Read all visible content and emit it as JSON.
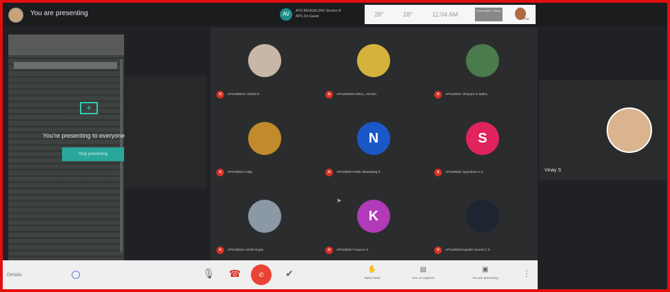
{
  "topbar": {
    "presenting_label": "You are presenting",
    "meeting_badge": "AV",
    "meeting_line1": "APS BENGALURU Section-A",
    "meeting_line2": "APS Zin-Gaute",
    "temp": "28°",
    "weather": "28°",
    "time": "11:04 AM",
    "presenter_chip": "Presentation: Vinay",
    "you_label": "You"
  },
  "share": {
    "headline": "You're presenting to everyone",
    "stop_label": "Stop presenting"
  },
  "participants": [
    {
      "name": "APS180001C Shalini R",
      "initial": "",
      "color": "#c7b7a4"
    },
    {
      "name": "APS180002A KRUL_AKASH",
      "initial": "",
      "color": "#d4b23c"
    },
    {
      "name": "APS180017 Shriyans G Mathu",
      "initial": "",
      "color": "#4a7b4d"
    },
    {
      "name": "APS180022 Uday",
      "initial": "",
      "color": "#c18a2c"
    },
    {
      "name": "APS180024 Nithin Bharadwaj R",
      "initial": "N",
      "color": "#1a57c7"
    },
    {
      "name": "APS180031 Spandana H G",
      "initial": "S",
      "color": "#e0245e"
    },
    {
      "name": "APS180042 Ashish Gupta",
      "initial": "",
      "color": "#8b98a6"
    },
    {
      "name": "APS180047 Kavya K S",
      "initial": "K",
      "color": "#b03ab8"
    },
    {
      "name": "APS180053 Nandini Suresh C S",
      "initial": "",
      "color": "#1d2530"
    }
  ],
  "right_tile": {
    "name": "Vinay S"
  },
  "bottombar": {
    "left_label": "Details",
    "raise_hand": "Raise hand",
    "captions": "Turn on captions",
    "presenting": "You are presenting"
  }
}
